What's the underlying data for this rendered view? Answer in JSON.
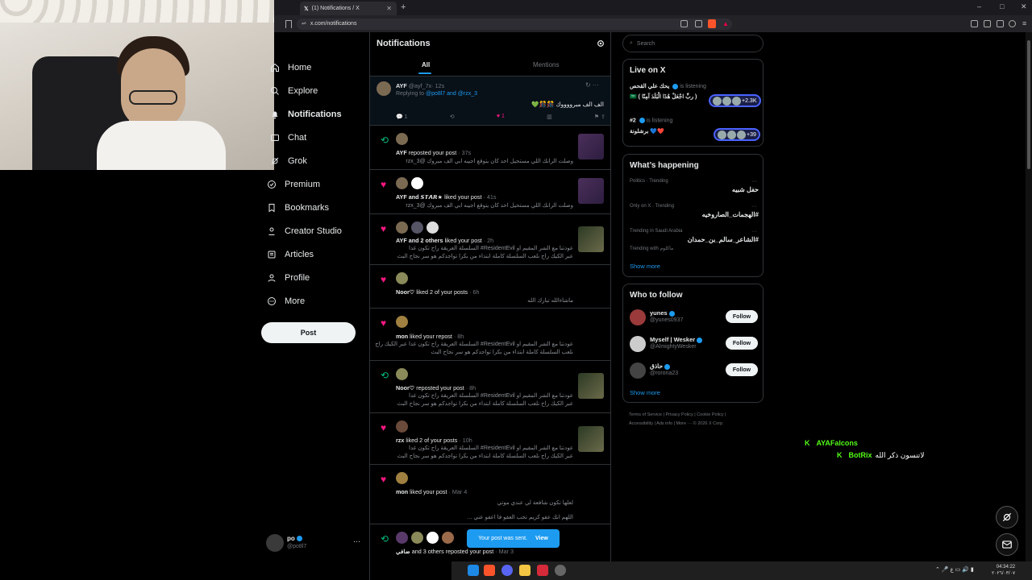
{
  "browser": {
    "tab_title": "(1) Notifications / X",
    "new_tab": "+",
    "url": "x.com/notifications",
    "window_controls": [
      "–",
      "□",
      "✕"
    ]
  },
  "nav": {
    "items": [
      {
        "label": "Home",
        "icon": "home-icon"
      },
      {
        "label": "Explore",
        "icon": "search-icon"
      },
      {
        "label": "Notifications",
        "icon": "bell-icon",
        "active": true
      },
      {
        "label": "Chat",
        "icon": "mail-icon"
      },
      {
        "label": "Grok",
        "icon": "grok-icon"
      },
      {
        "label": "Premium",
        "icon": "premium-icon"
      },
      {
        "label": "Bookmarks",
        "icon": "bookmark-icon"
      },
      {
        "label": "Creator Studio",
        "icon": "creator-icon"
      },
      {
        "label": "Articles",
        "icon": "articles-icon"
      },
      {
        "label": "Profile",
        "icon": "profile-icon"
      },
      {
        "label": "More",
        "icon": "more-circle-icon"
      }
    ],
    "post_button": "Post",
    "account": {
      "name": "po",
      "handle": "@po8l7",
      "more": "···"
    }
  },
  "main": {
    "title": "Notifications",
    "tabs": [
      "All",
      "Mentions"
    ],
    "reply": {
      "name": "AYF",
      "handle": "@ayf_7x",
      "time": "· 12s",
      "replying_prefix": "Replying to ",
      "replying_to": "@po8l7 and @rzx_3",
      "body": "الف الف مبرووووك 🎊🎊💚",
      "reply_count": "1",
      "like_count": "1"
    },
    "notifications": [
      {
        "type": "repost",
        "text_bold": "AYF",
        "text": " reposted your post",
        "time": " · 37s",
        "lines": [
          "وصلت الرانك اللي مستحيل احد كان يتوقع اجيبه ابي الف مبروك @rzx_3"
        ]
      },
      {
        "type": "like",
        "text_bold": "AYF and 𝙎𝙏𝘼𝙍★",
        "text": " liked your post",
        "time": " · 41s",
        "lines": [
          "وصلت الرانك اللي مستحيل احد كان يتوقع اجيبه ابي الف مبروك @rzx_3"
        ]
      },
      {
        "type": "like",
        "text_bold": "AYF and 2 others",
        "text": " liked your post",
        "time": " · 2h",
        "lines": [
          "عودتنا مع الشر المقيم او ResidentEvil# السلسلة العريقة راح تكون غدا",
          "عبر الكيك راح نلعب السلسلة كاملة ابتداء من بكرا تواجدكم هو سر نجاح البث"
        ]
      },
      {
        "type": "like",
        "text_bold": "Noor♡",
        "text": " liked 2 of your posts",
        "time": " · 6h",
        "lines": [
          "ماشاءالله تبارك الله"
        ]
      },
      {
        "type": "like",
        "text_bold": "mon",
        "text": " liked your repost",
        "time": " · 8h",
        "lines": [
          "عودتنا مع الشر المقيم او ResidentEvil# السلسلة العريقة راح تكون غدا عبر الكيك راح",
          "نلعب السلسلة كاملة ابتداء من بكرا تواجدكم هو سر نجاح البث"
        ]
      },
      {
        "type": "repost",
        "text_bold": "Noor♡",
        "text": " reposted your post",
        "time": " · 8h",
        "lines": [
          "عودتنا مع الشر المقيم او ResidentEvil# السلسلة العريقة راح تكون غدا",
          "عبر الكيك راح نلعب السلسلة كاملة ابتداء من بكرا تواجدكم هو سر نجاح البث"
        ]
      },
      {
        "type": "like",
        "text_bold": "rzx",
        "text": " liked 2 of your posts",
        "time": " · 10h",
        "lines": [
          "عودتنا مع الشر المقيم او ResidentEvil# السلسلة العريقة راح تكون غدا",
          "عبر الكيك راح نلعب السلسلة كاملة ابتداء من بكرا تواجدكم هو سر نجاح البث"
        ]
      },
      {
        "type": "like",
        "text_bold": "mon",
        "text": " liked your post",
        "time": " · Mar 4",
        "lines": [
          "لعلها تكون شافعة لي عندي موتي",
          "اللهم انك عفو كريم تحب العفو فا اعفو عني ..."
        ]
      },
      {
        "type": "repost",
        "text_bold": "ضافي",
        "text": " and 3 others reposted your post",
        "time": " · Mar 3",
        "lines": []
      }
    ],
    "toast": {
      "text": "Your post was sent.",
      "action": "View"
    }
  },
  "right": {
    "search_placeholder": "Search",
    "live": {
      "title": "Live on X",
      "items": [
        {
          "host": "يحك علي القحص",
          "status": "is listening",
          "title": "( ربِّ اجْعَلْ هَٰذَا الْبَلَدَ آمِنًا ) 🇸🇦",
          "count": "+2.3K"
        },
        {
          "host": "#2",
          "status": "is listening",
          "title": "برشلونة 💙❤️",
          "count": "+39"
        }
      ]
    },
    "happening": {
      "title": "What’s happening",
      "trends": [
        {
          "category": "Politics · Trending",
          "topic": "حفل شبيه"
        },
        {
          "category": "Only on X · Trending",
          "topic": "#الهجمات_الصاروخيه"
        },
        {
          "category": "Trending in Saudi Arabia",
          "topic": "#الشاعر_سالم_بن_حمدان",
          "extra": "Trending with ماكلوم"
        }
      ],
      "show_more": "Show more"
    },
    "who_to_follow": {
      "title": "Who to follow",
      "users": [
        {
          "name": "yunes",
          "handle": "@yunes0937",
          "button": "Follow"
        },
        {
          "name": "Myself | Wesker",
          "handle": "@AlmightyWesker",
          "button": "Follow"
        },
        {
          "name": "حاذق",
          "handle": "@rorona23",
          "button": "Follow"
        }
      ],
      "show_more": "Show more"
    },
    "footer": [
      "Terms of Service",
      "|",
      "Privacy Policy",
      "|",
      "Cookie Policy",
      "|",
      "Accessibility",
      "|",
      "Ads info",
      "|",
      "More ···",
      "© 2026 X Corp."
    ]
  },
  "stream_chat": [
    {
      "user": "AYAFalcons",
      "msg": ""
    },
    {
      "user": "BotRix",
      "msg": "لاتنسون ذكر الله"
    }
  ],
  "taskbar": {
    "time": "04:34:22",
    "date": "٢٠٢٦/٠٣/٠٧",
    "lang": "ع"
  }
}
